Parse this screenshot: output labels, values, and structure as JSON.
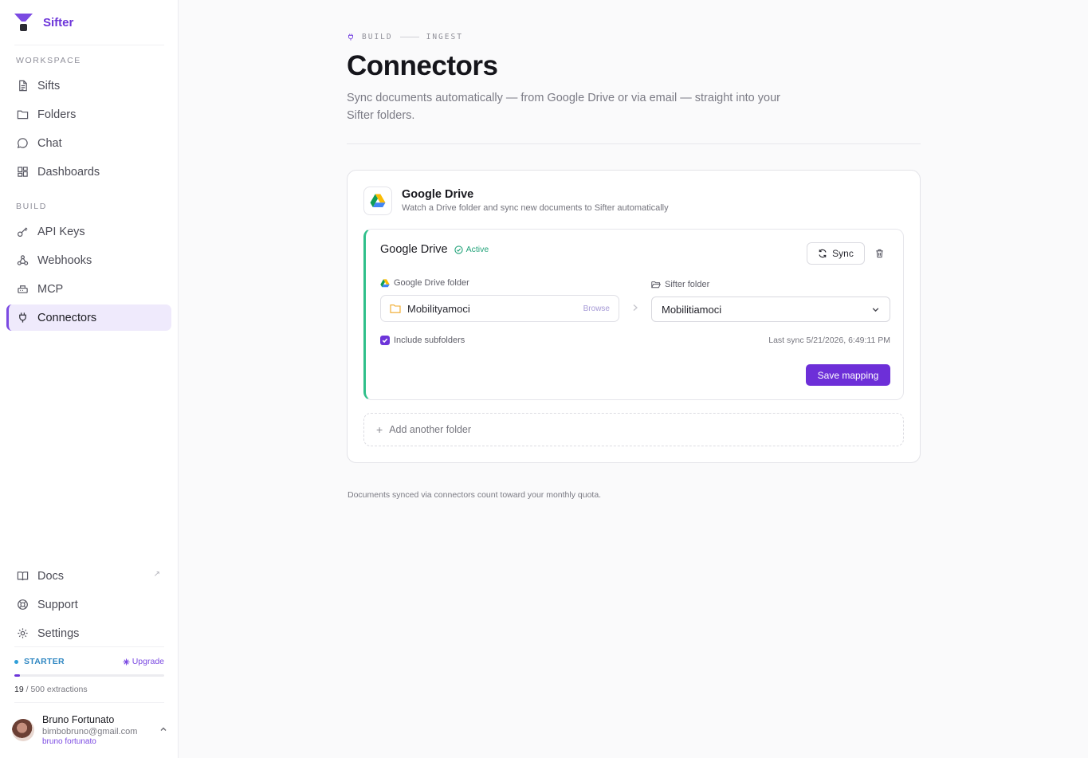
{
  "brand": {
    "name": "Sifter"
  },
  "sidebar": {
    "workspace_label": "WORKSPACE",
    "build_label": "BUILD",
    "workspace_items": [
      {
        "label": "Sifts",
        "icon": "document-icon"
      },
      {
        "label": "Folders",
        "icon": "folder-icon"
      },
      {
        "label": "Chat",
        "icon": "chat-bubble-icon"
      },
      {
        "label": "Dashboards",
        "icon": "grid-icon"
      }
    ],
    "build_items": [
      {
        "label": "API Keys",
        "icon": "key-icon"
      },
      {
        "label": "Webhooks",
        "icon": "webhook-icon"
      },
      {
        "label": "MCP",
        "icon": "server-icon"
      },
      {
        "label": "Connectors",
        "icon": "plug-icon",
        "active": true
      }
    ],
    "bottom_items": [
      {
        "label": "Docs",
        "icon": "book-icon",
        "external": true
      },
      {
        "label": "Support",
        "icon": "lifebuoy-icon"
      },
      {
        "label": "Settings",
        "icon": "gear-icon"
      }
    ],
    "ext_arrow": "↗",
    "plan": {
      "tier": "STARTER",
      "upgrade_label": "Upgrade",
      "used": "19",
      "usage_suffix": " / 500 extractions",
      "usage_fraction": 0.038
    },
    "user": {
      "name": "Bruno Fortunato",
      "email": "bimbobruno@gmail.com",
      "handle": "bruno fortunato"
    }
  },
  "main": {
    "breadcrumb": [
      "BUILD",
      "INGEST"
    ],
    "title": "Connectors",
    "subtitle": "Sync documents automatically — from Google Drive or via email — straight into your Sifter folders.",
    "connector": {
      "name": "Google Drive",
      "description": "Watch a Drive folder and sync new documents to Sifter automatically",
      "mapping": {
        "name": "Google Drive",
        "status": "Active",
        "sync_label": "Sync",
        "drive_folder_label": "Google Drive folder",
        "drive_folder_value": "Mobilityamoci",
        "browse_label": "Browse",
        "sifter_folder_label": "Sifter folder",
        "sifter_folder_value": "Mobilitiamoci",
        "include_subfolders_label": "Include subfolders",
        "include_subfolders": true,
        "last_sync": "Last sync 5/21/2026, 6:49:11 PM",
        "save_label": "Save mapping"
      },
      "add_folder_label": "Add another folder"
    },
    "footnote": "Documents synced via connectors count toward your monthly quota."
  },
  "colors": {
    "accent": "#6d35d9",
    "active_status": "#23a37a",
    "mapping_border": "#2fbf8a",
    "plan": "#2f87c2"
  }
}
